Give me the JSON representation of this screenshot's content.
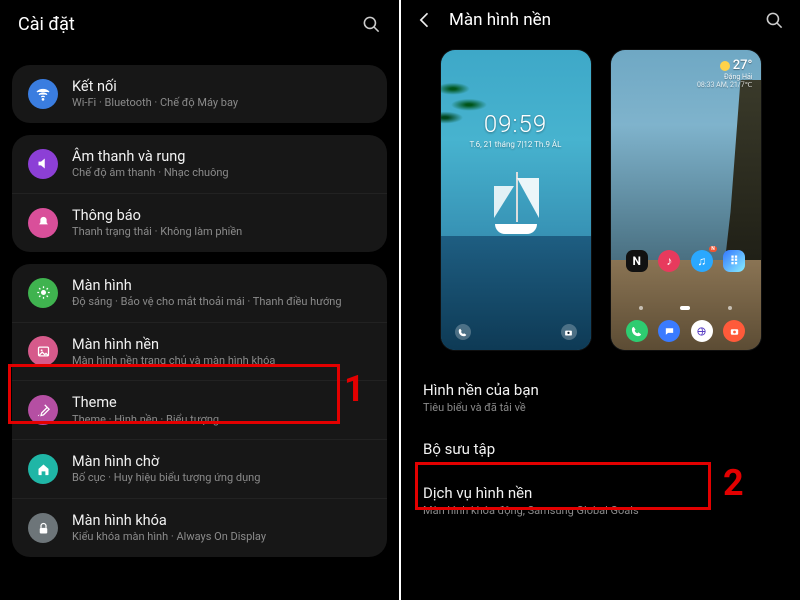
{
  "left": {
    "title": "Cài đặt",
    "groups": [
      {
        "items": [
          {
            "key": "connections",
            "icon": "wifi",
            "color": "#3a7de0",
            "label": "Kết nối",
            "sub": "Wi-Fi · Bluetooth · Chế độ Máy bay"
          }
        ]
      },
      {
        "items": [
          {
            "key": "sound",
            "icon": "speaker",
            "color": "#8c3fd6",
            "label": "Âm thanh và rung",
            "sub": "Chế độ âm thanh · Nhạc chuông"
          },
          {
            "key": "notifications",
            "icon": "bell",
            "color": "#d94f9a",
            "label": "Thông báo",
            "sub": "Thanh trạng thái · Không làm phiền"
          }
        ]
      },
      {
        "items": [
          {
            "key": "display",
            "icon": "sun",
            "color": "#3fb34f",
            "label": "Màn hình",
            "sub": "Độ sáng · Bảo vệ cho mắt thoải mái · Thanh điều hướng"
          },
          {
            "key": "wallpaper",
            "icon": "image",
            "color": "#d65a8b",
            "label": "Màn hình nền",
            "sub": "Màn hình nền trang chủ và màn hình khóa"
          },
          {
            "key": "theme",
            "icon": "brush",
            "color": "#b54fa3",
            "label": "Theme",
            "sub": "Theme · Hình nền · Biểu tượng"
          },
          {
            "key": "home",
            "icon": "house",
            "color": "#1fb6a6",
            "label": "Màn hình chờ",
            "sub": "Bố cục · Huy hiệu biểu tượng ứng dụng"
          },
          {
            "key": "lock",
            "icon": "lock",
            "color": "#6d7579",
            "label": "Màn hình khóa",
            "sub": "Kiểu khóa màn hình · Always On Display"
          }
        ]
      }
    ],
    "highlight": {
      "target_key": "wallpaper",
      "number": "1"
    }
  },
  "right": {
    "title": "Màn hình nền",
    "lock_preview": {
      "clock": "09:59",
      "date": "T.6, 21 tháng 7|12 Th.9 ÂL"
    },
    "home_preview": {
      "temp": "27°",
      "location": "Đặng Hải",
      "range": "08:33 AM, 21/7℃"
    },
    "list": [
      {
        "key": "yours",
        "label": "Hình nền của bạn",
        "sub": "Tiêu biểu và đã tải về"
      },
      {
        "key": "gallery",
        "label": "Bộ sưu tập",
        "sub": ""
      },
      {
        "key": "services",
        "label": "Dịch vụ hình nền",
        "sub": "Màn hình khóa động, Samsung Global Goals"
      }
    ],
    "highlight": {
      "target_key": "gallery",
      "number": "2"
    }
  }
}
